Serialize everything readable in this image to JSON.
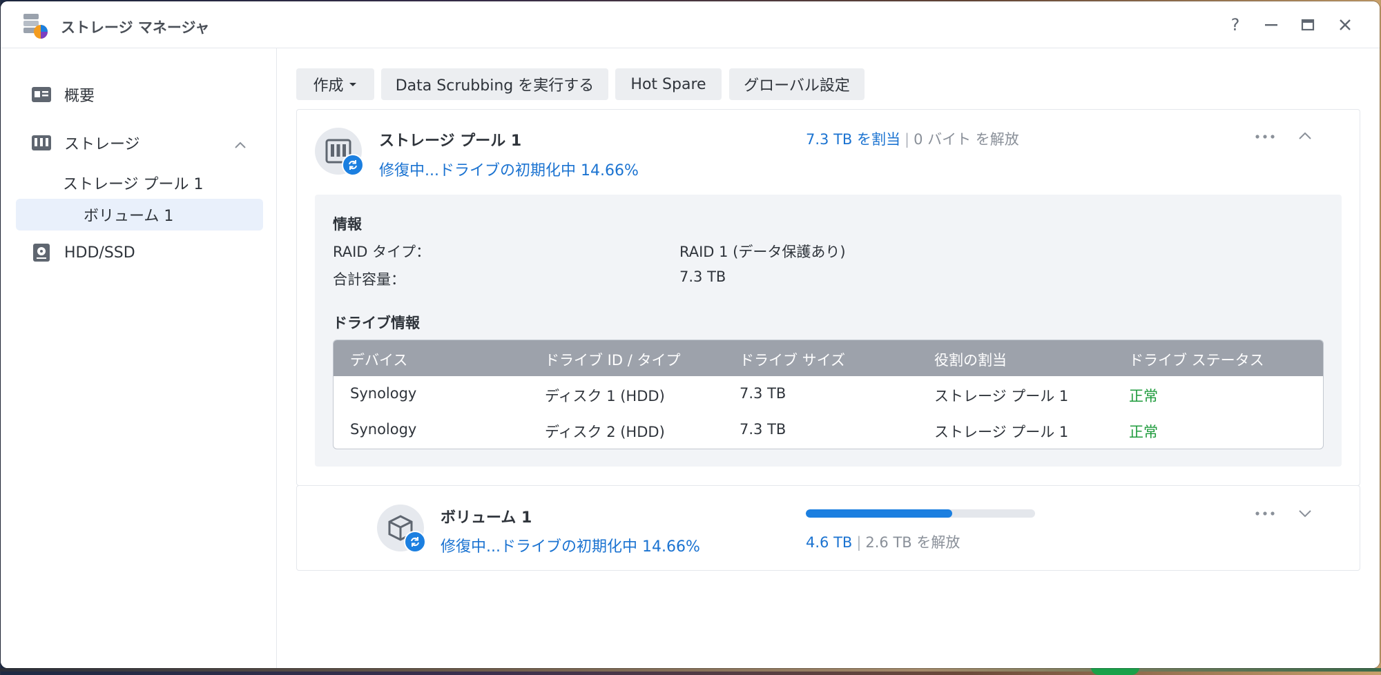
{
  "app": {
    "title": "ストレージ マネージャ",
    "help": "?"
  },
  "sidebar": {
    "items": [
      {
        "label": "概要"
      },
      {
        "label": "ストレージ"
      },
      {
        "label": "ストレージ プール 1"
      },
      {
        "label": "ボリューム 1"
      },
      {
        "label": "HDD/SSD"
      }
    ]
  },
  "toolbar": {
    "create": "作成",
    "scrub": "Data Scrubbing を実行する",
    "hotspare": "Hot Spare",
    "global": "グローバル設定"
  },
  "pool": {
    "title": "ストレージ プール 1",
    "status": "修復中...ドライブの初期化中 14.66%",
    "allocated": "7.3 TB を割当",
    "separator": "|",
    "free": "0 バイト を解放",
    "info": {
      "title": "情報",
      "raid_label": "RAID タイプ：",
      "raid_value": "RAID 1 (データ保護あり)",
      "total_label": "合計容量：",
      "total_value": "7.3 TB"
    },
    "drives": {
      "title": "ドライブ情報",
      "headers": [
        "デバイス",
        "ドライブ ID / タイプ",
        "ドライブ サイズ",
        "役割の割当",
        "ドライブ ステータス"
      ],
      "rows": [
        [
          "Synology",
          "ディスク 1 (HDD)",
          "7.3 TB",
          "ストレージ プール 1",
          "正常"
        ],
        [
          "Synology",
          "ディスク 2 (HDD)",
          "7.3 TB",
          "ストレージ プール 1",
          "正常"
        ]
      ]
    }
  },
  "volume": {
    "title": "ボリューム 1",
    "status": "修復中...ドライブの初期化中 14.66%",
    "used": "4.6 TB",
    "separator": "|",
    "free": "2.6 TB を解放",
    "usage_fraction": 0.64
  },
  "colors": {
    "accent": "#1b7fe0",
    "ok": "#1e9b3c",
    "table_header": "#9da2ab"
  }
}
